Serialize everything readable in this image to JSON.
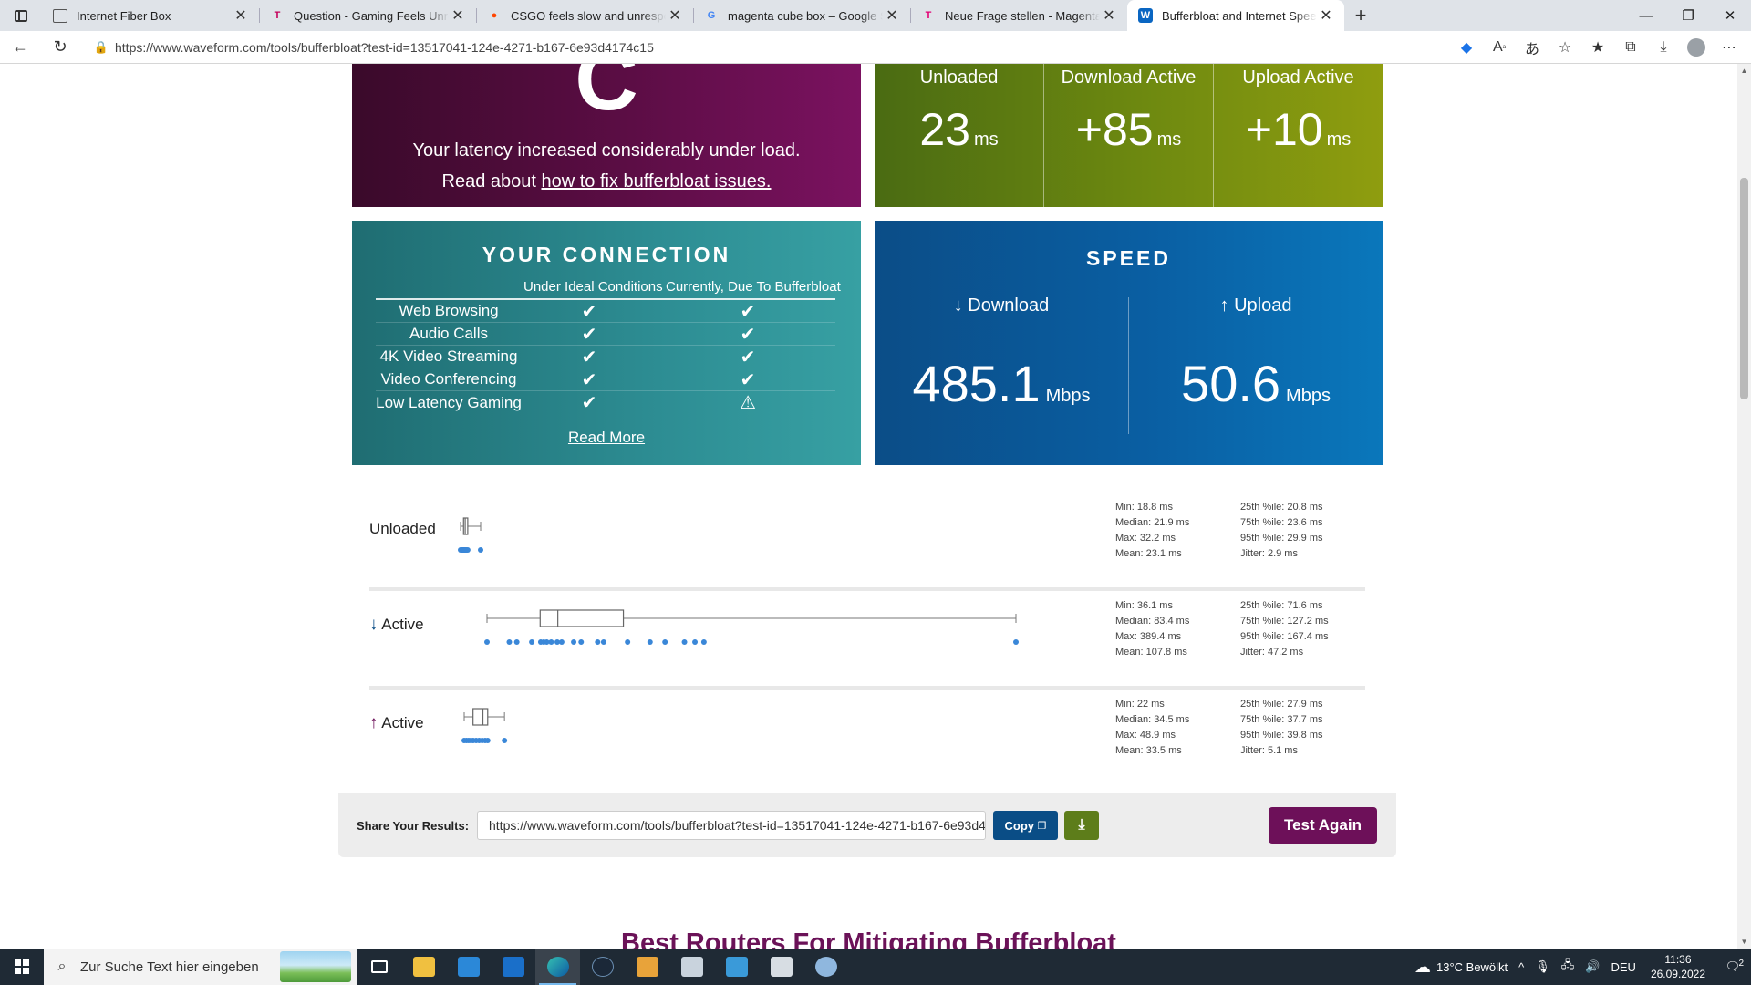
{
  "browser": {
    "tabs": [
      {
        "title": "Internet Fiber Box",
        "favicon": "page-icon",
        "fav_glyph": "",
        "fav_color": "#555555"
      },
      {
        "title": "Question - Gaming Feels Unresponsive",
        "favicon": "t-logo-icon",
        "fav_glyph": "T",
        "fav_color": "#c4005a"
      },
      {
        "title": "CSGO feels slow and unresposible",
        "favicon": "reddit-icon",
        "fav_glyph": "●",
        "fav_color": "#ff4500"
      },
      {
        "title": "magenta cube box – Google Suche",
        "favicon": "google-icon",
        "fav_glyph": "G",
        "fav_color": "#4285f4"
      },
      {
        "title": "Neue Frage stellen - Magenta Community",
        "favicon": "telekom-icon",
        "fav_glyph": "T",
        "fav_color": "#e20074"
      },
      {
        "title": "Bufferbloat and Internet Speed Test",
        "favicon": "waveform-icon",
        "fav_glyph": "W",
        "fav_color": "#0a66c2",
        "active": true
      }
    ],
    "url": "https://www.waveform.com/tools/bufferbloat?test-id=13517041-124e-4271-b167-6e93d4174c15"
  },
  "grade": {
    "letter": "C",
    "line1": "Your latency increased considerably under load.",
    "line2_prefix": "Read about ",
    "line2_link": "how to fix bufferbloat issues."
  },
  "latency": [
    {
      "label": "Unloaded",
      "value": "23",
      "unit": "ms"
    },
    {
      "label": "Download Active",
      "value": "+85",
      "unit": "ms"
    },
    {
      "label": "Upload Active",
      "value": "+10",
      "unit": "ms"
    }
  ],
  "connection": {
    "title": "YOUR CONNECTION",
    "col1": "Under Ideal Conditions",
    "col2": "Currently, Due To Bufferbloat",
    "rows": [
      {
        "name": "Web Browsing",
        "ideal": "✔",
        "current": "✔"
      },
      {
        "name": "Audio Calls",
        "ideal": "✔",
        "current": "✔"
      },
      {
        "name": "4K Video Streaming",
        "ideal": "✔",
        "current": "✔"
      },
      {
        "name": "Video Conferencing",
        "ideal": "✔",
        "current": "✔"
      },
      {
        "name": "Low Latency Gaming",
        "ideal": "✔",
        "current": "⚠"
      }
    ],
    "read_more": "Read More"
  },
  "speed": {
    "title": "SPEED",
    "download_label": "↓ Download",
    "download_value": "485.1",
    "upload_label": "↑ Upload",
    "upload_value": "50.6",
    "unit": "Mbps"
  },
  "latency_plots": [
    {
      "label": "Unloaded",
      "arrow": "",
      "min": 18.8,
      "q1": 20.8,
      "median": 21.9,
      "q3": 23.6,
      "max": 32.2,
      "samples": [
        18.8,
        19.5,
        20.0,
        20.5,
        20.8,
        21.2,
        21.6,
        21.9,
        22.3,
        22.8,
        23.6,
        32.2
      ],
      "stats_left": [
        "Min: 18.8 ms",
        "Median: 21.9 ms",
        "Max: 32.2 ms",
        "Mean: 23.1 ms"
      ],
      "stats_right": [
        "25th %ile: 20.8 ms",
        "75th %ile: 23.6 ms",
        "95th %ile: 29.9 ms",
        "Jitter: 2.9 ms"
      ]
    },
    {
      "label": "Active",
      "arrow": "↓",
      "min": 36.1,
      "q1": 71.6,
      "median": 83.4,
      "q3": 127.2,
      "max": 389.4,
      "samples": [
        36.1,
        51,
        56,
        66,
        72,
        74,
        76,
        79,
        83,
        86,
        94,
        99,
        110,
        114,
        130,
        145,
        155,
        168,
        175,
        181,
        389.4
      ],
      "stats_left": [
        "Min: 36.1 ms",
        "Median: 83.4 ms",
        "Max: 389.4 ms",
        "Mean: 107.8 ms"
      ],
      "stats_right": [
        "25th %ile: 71.6 ms",
        "75th %ile: 127.2 ms",
        "95th %ile: 167.4 ms",
        "Jitter: 47.2 ms"
      ]
    },
    {
      "label": "Active",
      "arrow": "↑",
      "min": 22,
      "q1": 27.9,
      "median": 34.5,
      "q3": 37.7,
      "max": 48.9,
      "samples": [
        22,
        23.5,
        25,
        26.5,
        28,
        30,
        32,
        34,
        36,
        37.7,
        48.9
      ],
      "stats_left": [
        "Min: 22 ms",
        "Median: 34.5 ms",
        "Max: 48.9 ms",
        "Mean: 33.5 ms"
      ],
      "stats_right": [
        "25th %ile: 27.9 ms",
        "75th %ile: 37.7 ms",
        "95th %ile: 39.8 ms",
        "Jitter: 5.1 ms"
      ]
    }
  ],
  "share": {
    "label": "Share Your Results:",
    "url": "https://www.waveform.com/tools/bufferbloat?test-id=13517041-124e-4271-b167-6e93d4174c15",
    "copy_label": "Copy",
    "download_icon": "download-icon",
    "test_again": "Test Again"
  },
  "section_heading": "Best Routers For Mitigating Bufferbloat",
  "taskbar": {
    "search_placeholder": "Zur Suche Text hier eingeben",
    "weather": "13°C  Bewölkt",
    "language": "DEU",
    "time": "11:36",
    "date": "26.09.2022",
    "notifications": "2"
  },
  "colors": {
    "grade_bg": "#5c0d45",
    "latency_bg": "#6f8a10",
    "connection_bg": "#2d8d93",
    "speed_bg": "#0a5fa3",
    "sample_dot": "#3a87d8",
    "test_again_bg": "#6d1059"
  }
}
